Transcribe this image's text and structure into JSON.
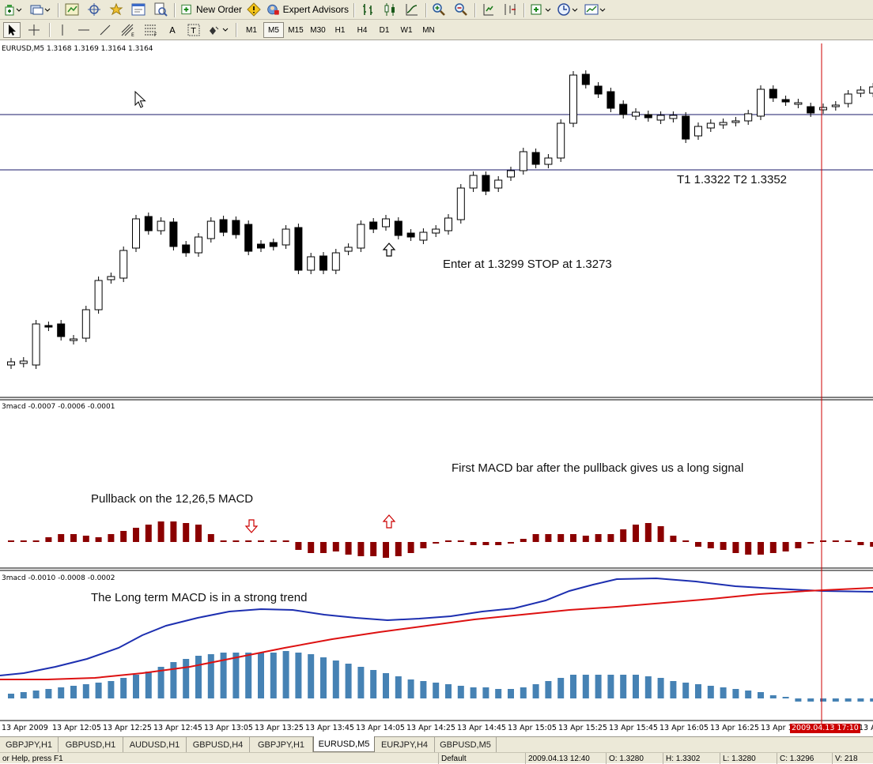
{
  "toolbar": {
    "new_order_label": "New Order",
    "expert_advisors_label": "Expert Advisors",
    "timeframes": [
      "M1",
      "M5",
      "M15",
      "M30",
      "H1",
      "H4",
      "D1",
      "W1",
      "MN"
    ],
    "active_timeframe": "M5"
  },
  "main_chart": {
    "header": "EURUSD,M5  1.3168 1.3169 1.3164 1.3164",
    "annotation_targets": "T1 1.3322 T2 1.3352",
    "annotation_entry": "Enter at 1.3299 STOP at 1.3273"
  },
  "macd_short": {
    "header": "3macd -0.0007 -0.0006 -0.0001",
    "annotation_signal": "First MACD bar after the pullback gives us a long signal",
    "annotation_pullback": "Pullback on the 12,26,5 MACD"
  },
  "macd_long": {
    "header": "3macd -0.0010 -0.0008 -0.0002",
    "annotation_trend": "The Long term MACD is in a strong trend"
  },
  "time_axis": {
    "labels": [
      "13 Apr 2009",
      "13 Apr 12:05",
      "13 Apr 12:25",
      "13 Apr 12:45",
      "13 Apr 13:05",
      "13 Apr 13:25",
      "13 Apr 13:45",
      "13 Apr 14:05",
      "13 Apr 14:25",
      "13 Apr 14:45",
      "13 Apr 15:05",
      "13 Apr 15:25",
      "13 Apr 15:45",
      "13 Apr 16:05",
      "13 Apr 16:25",
      "13 Apr 16"
    ],
    "cursor_label": "2009.04.13 17:10",
    "cursor_color": "#cc0000",
    "trailing_label": "13 A"
  },
  "tabs": [
    "GBPJPY,H1",
    "GBPUSD,H1",
    "AUDUSD,H1",
    "GBPUSD,H4",
    "GBPJPY,H1",
    "EURUSD,M5",
    "EURJPY,H4",
    "GBPUSD,M5"
  ],
  "active_tab": "EURUSD,M5",
  "status": {
    "help": "or Help, press F1",
    "profile": "Default",
    "datetime": "2009.04.13 12:40",
    "open": "O: 1.3280",
    "high": "H: 1.3302",
    "low": "L: 1.3280",
    "close": "C: 1.3296",
    "volume": "V: 218"
  },
  "colors": {
    "bull_candle": "#ffffff",
    "bear_candle": "#000000",
    "short_macd_hist": "#8b0000",
    "long_macd_hist": "#4682b4",
    "long_macd_main": "#1d2fb0",
    "long_macd_signal": "#dd1111",
    "cursor_line": "#cc0000",
    "level_lines": "#1a1a6a"
  },
  "chart_data": [
    {
      "type": "candlestick",
      "symbol": "EURUSD",
      "timeframe": "M5",
      "title": "EURUSD,M5  1.3168 1.3169 1.3164 1.3164",
      "horizontal_levels": [
        1.3322,
        1.3352
      ],
      "annotations": [
        "T1 1.3322 T2 1.3352",
        "Enter at 1.3299 STOP at 1.3273"
      ]
    },
    {
      "type": "bar",
      "title": "3macd -0.0007 -0.0006 -0.0001",
      "annotations": [
        "First MACD bar after the pullback gives us a long signal",
        "Pullback on the 12,26,5 MACD"
      ]
    },
    {
      "type": "line",
      "title": "3macd -0.0010 -0.0008 -0.0002",
      "annotations": [
        "The Long term MACD is in a strong trend"
      ]
    }
  ]
}
